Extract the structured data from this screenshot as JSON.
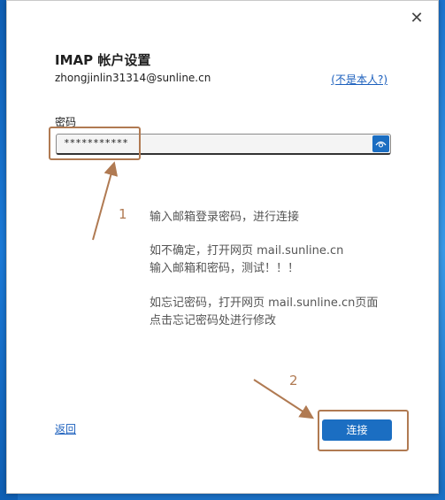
{
  "dialog": {
    "title": "IMAP 帐户设置",
    "email": "zhongjinlin31314@sunline.cn",
    "not_me_link": "(不是本人?)",
    "close_glyph": "✕"
  },
  "password": {
    "label": "密码",
    "value": "***********",
    "reveal_icon": "eye-icon"
  },
  "annotations": {
    "step1_number": "1",
    "step2_number": "2",
    "lines": [
      "输入邮箱登录密码，进行连接",
      "如不确定，打开网页 mail.sunline.cn",
      "输入邮箱和密码，测试！！！",
      "如忘记密码，打开网页 mail.sunline.cn页面",
      "点击忘记密码处进行修改"
    ],
    "accent_color": "#b07a52"
  },
  "footer": {
    "back_link": "返回",
    "connect_button": "连接"
  },
  "colors": {
    "primary": "#1b6ec2",
    "link": "#1b5fbd",
    "desktop": "#1a6fc4"
  }
}
